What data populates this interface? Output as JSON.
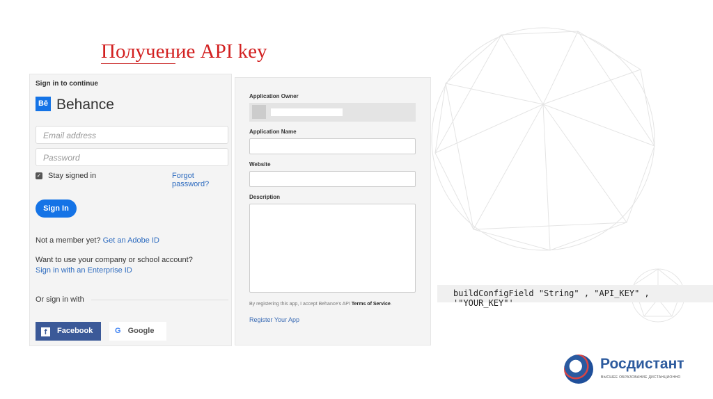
{
  "slide": {
    "title": "Получение API key"
  },
  "signin": {
    "heading": "Sign in to continue",
    "brand": "Behance",
    "brand_logo": "Bē",
    "email_placeholder": "Email address",
    "password_placeholder": "Password",
    "stay_signed_in": "Stay signed in",
    "stay_signed_in_checked": true,
    "forgot": "Forgot password?",
    "sign_in": "Sign In",
    "not_member": "Not a member yet?",
    "get_adobe_id": "Get an Adobe ID",
    "company_q": "Want to use your company or school account?",
    "enterprise": "Sign in with an Enterprise ID",
    "or_sign_in": "Or sign in with",
    "facebook": "Facebook",
    "google": "Google",
    "accent": "#1473e6"
  },
  "register": {
    "owner_label": "Application Owner",
    "name_label": "Application Name",
    "website_label": "Website",
    "description_label": "Description",
    "terms_prefix": "By registering this app, I accept Behance's API",
    "terms_link": "Terms of Service",
    "terms_suffix": ".",
    "register": "Register Your App"
  },
  "code": {
    "text": "buildConfigField \"String\" , \"API_KEY\" , '\"YOUR_KEY\"'"
  },
  "logo": {
    "name": "Росдистант",
    "tagline": "ВЫСШЕЕ ОБРАЗОВАНИЕ ДИСТАНЦИОННО"
  }
}
